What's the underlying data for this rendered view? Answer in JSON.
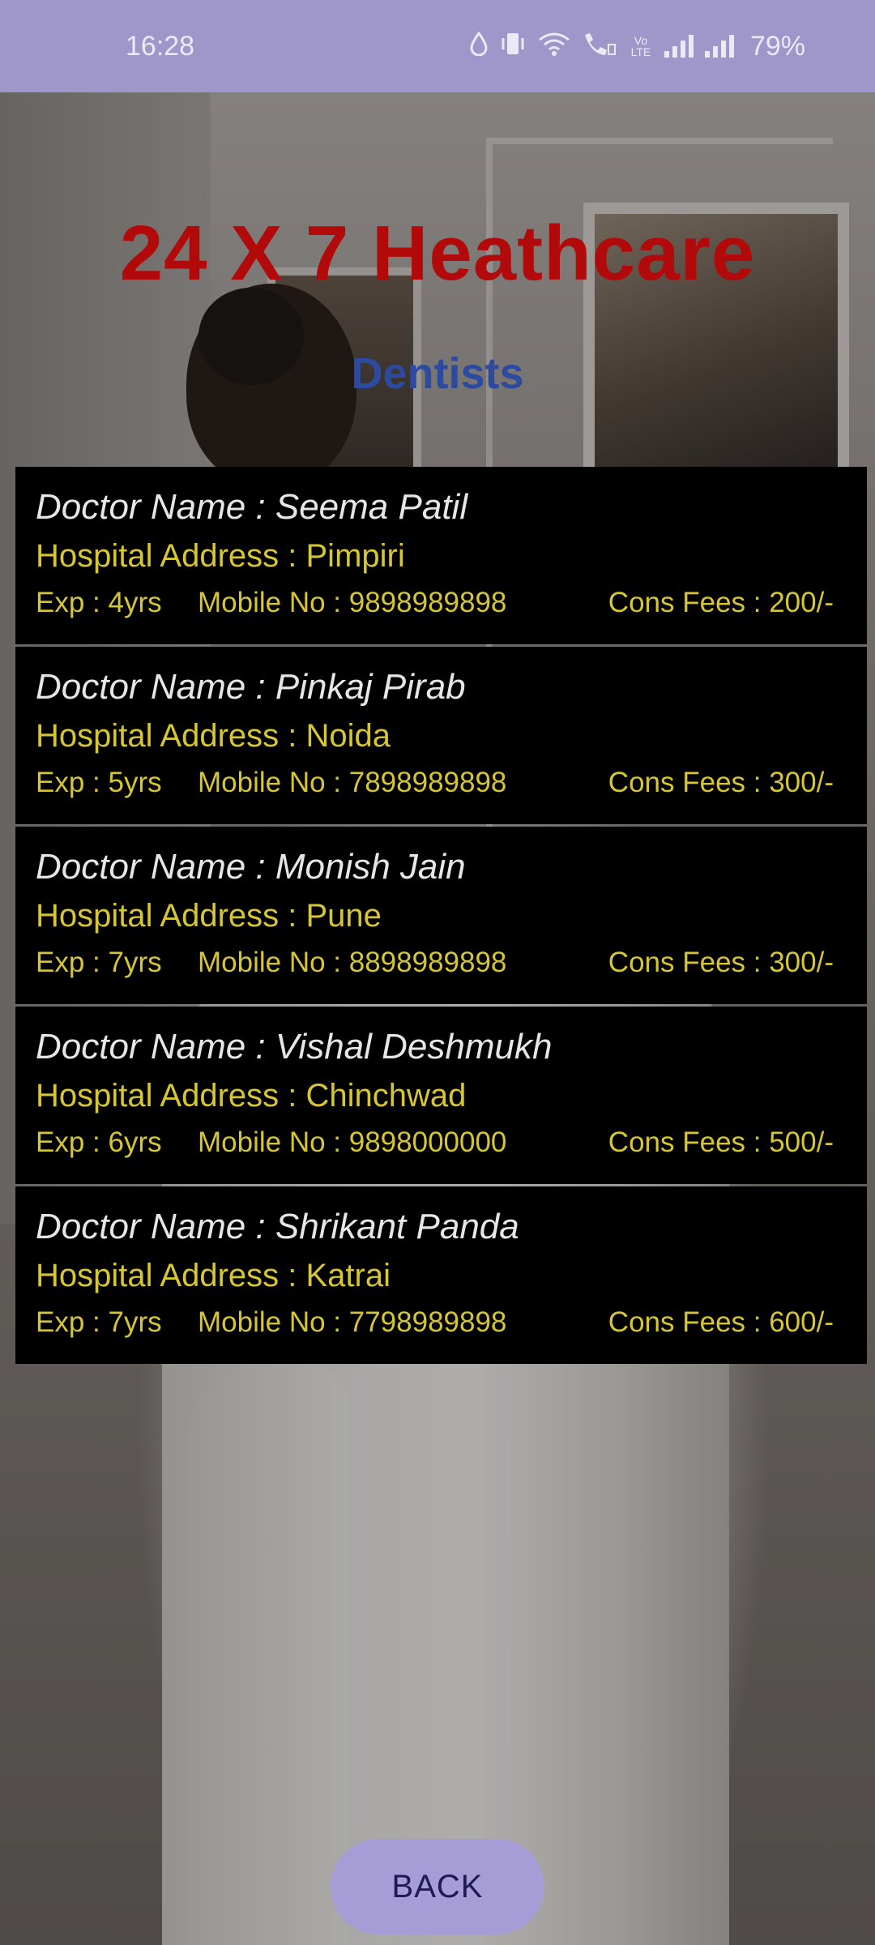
{
  "status_bar": {
    "time": "16:28",
    "battery": "79%",
    "icons": [
      "water-drop-icon",
      "vibrate-icon",
      "wifi-icon",
      "wifi-calling-icon",
      "volte-icon",
      "signal-icon",
      "signal-icon"
    ],
    "volte_text": "Vo LTE"
  },
  "app": {
    "title": "24 X 7 Heathcare",
    "subtitle": "Dentists"
  },
  "doctors": [
    {
      "name": "Doctor Name : Seema Patil",
      "address": "Hospital Address : Pimpiri",
      "exp": "Exp : 4yrs",
      "mobile": "Mobile No : 9898989898",
      "fees": "Cons Fees : 200/-"
    },
    {
      "name": "Doctor Name : Pinkaj Pirab",
      "address": "Hospital Address : Noida",
      "exp": "Exp : 5yrs",
      "mobile": "Mobile No : 7898989898",
      "fees": "Cons Fees : 300/-"
    },
    {
      "name": "Doctor Name : Monish Jain",
      "address": "Hospital Address : Pune",
      "exp": "Exp : 7yrs",
      "mobile": "Mobile No : 8898989898",
      "fees": "Cons Fees : 300/-"
    },
    {
      "name": "Doctor Name : Vishal Deshmukh",
      "address": "Hospital Address : Chinchwad",
      "exp": "Exp : 6yrs",
      "mobile": "Mobile No : 9898000000",
      "fees": "Cons Fees : 500/-"
    },
    {
      "name": "Doctor Name : Shrikant Panda",
      "address": "Hospital Address : Katrai",
      "exp": "Exp : 7yrs",
      "mobile": "Mobile No : 7798989898",
      "fees": "Cons Fees : 600/-"
    }
  ],
  "back_button": {
    "label": "BACK"
  },
  "colors": {
    "status_bar": "#9f97c9",
    "title": "#b20a0a",
    "subtitle": "#2b4aa0",
    "card_bg": "#000000",
    "name_text": "#e6e6e6",
    "detail_text": "#d7c634",
    "button_bg": "#a69dd6",
    "button_text": "#1f1a55"
  }
}
